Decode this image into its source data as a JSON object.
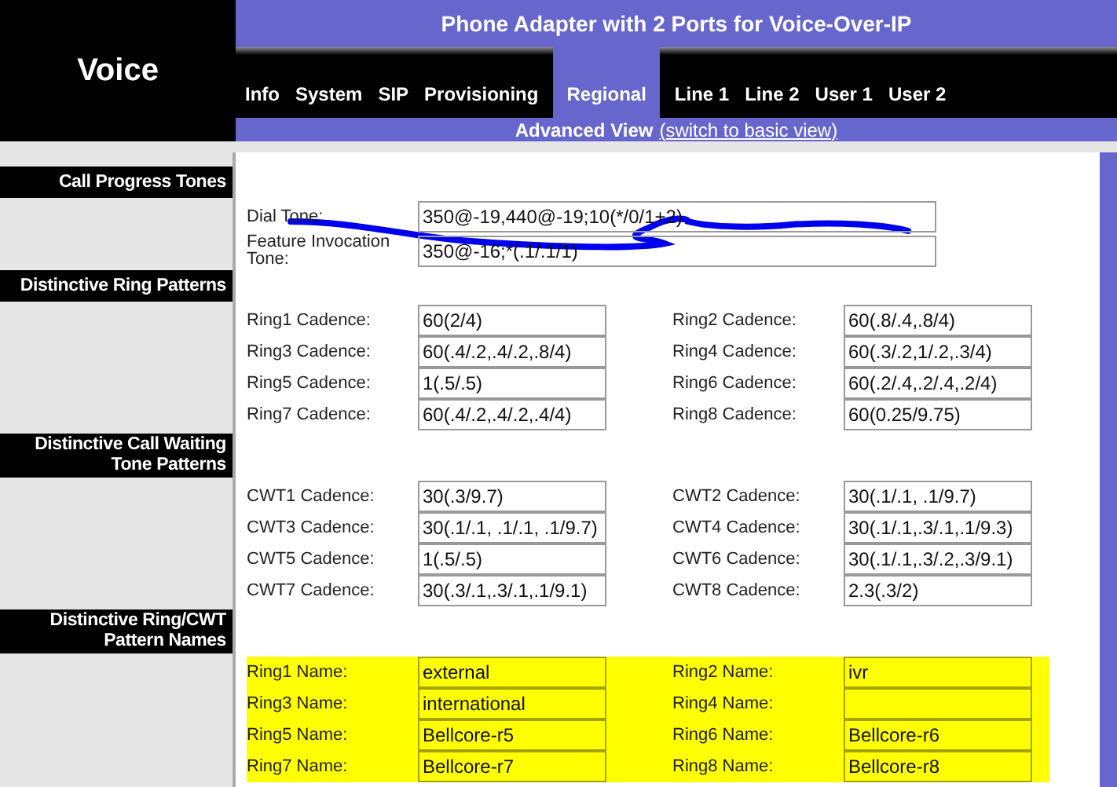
{
  "brand": "Voice",
  "title": "Phone Adapter with 2 Ports for Voice-Over-IP",
  "tabs": [
    {
      "label": "Info",
      "selected": false
    },
    {
      "label": "System",
      "selected": false
    },
    {
      "label": "SIP",
      "selected": false
    },
    {
      "label": "Provisioning",
      "selected": false
    },
    {
      "label": "Regional",
      "selected": true
    },
    {
      "label": "Line 1",
      "selected": false
    },
    {
      "label": "Line 2",
      "selected": false
    },
    {
      "label": "User 1",
      "selected": false
    },
    {
      "label": "User 2",
      "selected": false
    }
  ],
  "view_bar": {
    "text": "Advanced View",
    "link": "(switch to basic view)"
  },
  "sections": [
    {
      "title": "Call Progress Tones",
      "kind": "wide",
      "highlighted": false,
      "fields": [
        {
          "label": "Dial Tone:",
          "value": "350@-19,440@-19;10(*/0/1+2)"
        },
        {
          "label": "Feature Invocation Tone:",
          "value": "350@-16;*(.1/.1/1)"
        }
      ]
    },
    {
      "title": "Distinctive Ring Patterns",
      "kind": "pairs",
      "highlighted": false,
      "fields": [
        {
          "label": "Ring1 Cadence:",
          "value": "60(2/4)"
        },
        {
          "label": "Ring2 Cadence:",
          "value": "60(.8/.4,.8/4)"
        },
        {
          "label": "Ring3 Cadence:",
          "value": "60(.4/.2,.4/.2,.8/4)"
        },
        {
          "label": "Ring4 Cadence:",
          "value": "60(.3/.2,1/.2,.3/4)"
        },
        {
          "label": "Ring5 Cadence:",
          "value": "1(.5/.5)"
        },
        {
          "label": "Ring6 Cadence:",
          "value": "60(.2/.4,.2/.4,.2/4)"
        },
        {
          "label": "Ring7 Cadence:",
          "value": "60(.4/.2,.4/.2,.4/4)"
        },
        {
          "label": "Ring8 Cadence:",
          "value": "60(0.25/9.75)"
        }
      ]
    },
    {
      "title": "Distinctive Call Waiting Tone Patterns",
      "kind": "pairs",
      "highlighted": false,
      "fields": [
        {
          "label": "CWT1 Cadence:",
          "value": "30(.3/9.7)"
        },
        {
          "label": "CWT2 Cadence:",
          "value": "30(.1/.1, .1/9.7)"
        },
        {
          "label": "CWT3 Cadence:",
          "value": "30(.1/.1, .1/.1, .1/9.7)"
        },
        {
          "label": "CWT4 Cadence:",
          "value": "30(.1/.1,.3/.1,.1/9.3)"
        },
        {
          "label": "CWT5 Cadence:",
          "value": "1(.5/.5)"
        },
        {
          "label": "CWT6 Cadence:",
          "value": "30(.1/.1,.3/.2,.3/9.1)"
        },
        {
          "label": "CWT7 Cadence:",
          "value": "30(.3/.1,.3/.1,.1/9.1)"
        },
        {
          "label": "CWT8 Cadence:",
          "value": "2.3(.3/2)"
        }
      ]
    },
    {
      "title": "Distinctive Ring/CWT Pattern Names",
      "kind": "pairs",
      "highlighted": true,
      "fields": [
        {
          "label": "Ring1 Name:",
          "value": "external"
        },
        {
          "label": "Ring2 Name:",
          "value": "ivr"
        },
        {
          "label": "Ring3 Name:",
          "value": "international"
        },
        {
          "label": "Ring4 Name:"
        },
        {
          "label": "Ring5 Name:",
          "value": "Bellcore-r5"
        },
        {
          "label": "Ring6 Name:",
          "value": "Bellcore-r6"
        },
        {
          "label": "Ring7 Name:",
          "value": "Bellcore-r7"
        },
        {
          "label": "Ring8 Name:",
          "value": "Bellcore-r8"
        }
      ]
    }
  ]
}
